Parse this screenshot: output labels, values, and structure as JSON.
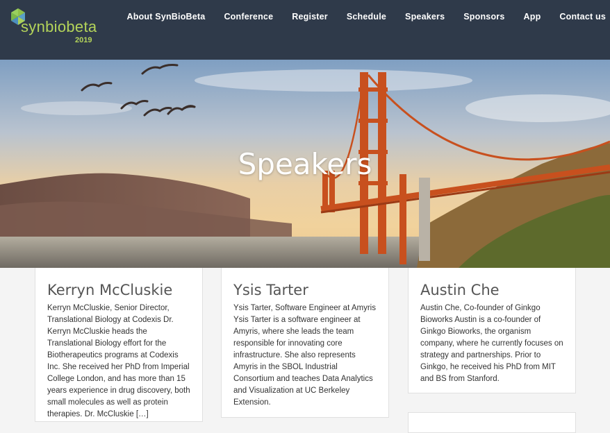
{
  "header": {
    "logo_text": "synbiobeta",
    "logo_year": "2019",
    "nav": [
      "About SynBioBeta",
      "Conference",
      "Register",
      "Schedule",
      "Speakers",
      "Sponsors",
      "App",
      "Contact us"
    ]
  },
  "hero": {
    "title": "Speakers"
  },
  "speakers": [
    {
      "name": "Kerryn McCluskie",
      "bio": "Kerryn McCluskie, Senior Director, Translational Biology at Codexis Dr. Kerryn McCluskie heads the Translational Biology effort for the Biotherapeutics programs at Codexis Inc. She received her PhD from Imperial College London, and has more than 15 years experience in drug discovery, both small molecules as well as protein therapies. Dr. McCluskie […]"
    },
    {
      "name": "Ysis Tarter",
      "bio": "Ysis Tarter, Software Engineer at Amyris Ysis Tarter is a software engineer at Amyris, where she leads the team responsible for innovating core infrastructure. She also represents Amyris in the SBOL Industrial Consortium and teaches Data Analytics and Visualization at UC Berkeley Extension."
    },
    {
      "name": "Austin Che",
      "bio": "Austin Che, Co-founder of Ginkgo Bioworks Austin is a co-founder of Ginkgo Bioworks, the organism company, where he currently focuses on strategy and partnerships. Prior to Ginkgo, he received his PhD from MIT and BS from Stanford."
    }
  ],
  "colors": {
    "navbar": "#2f3a4a",
    "logo_green": "#b4d45a",
    "bridge": "#c8501e"
  }
}
